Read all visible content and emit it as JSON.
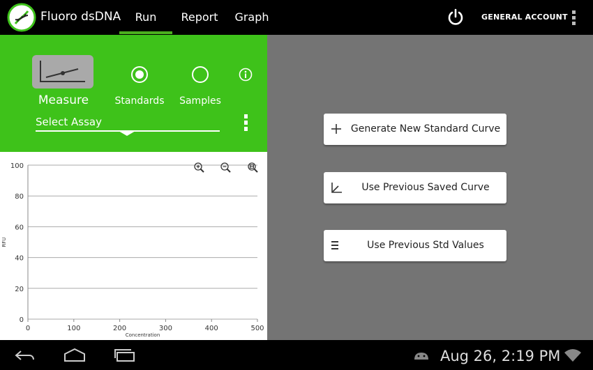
{
  "app": {
    "title": "Fluoro dsDNA",
    "tabs": [
      {
        "label": "Run",
        "active": true
      },
      {
        "label": "Report",
        "active": false
      },
      {
        "label": "Graph",
        "active": false
      }
    ],
    "account_label": "GENERAL ACCOUNT",
    "accent_color": "#4caf1f"
  },
  "run_panel": {
    "measure_label": "Measure",
    "options": [
      {
        "label": "Standards",
        "selected": true
      },
      {
        "label": "Samples",
        "selected": false
      }
    ],
    "assay_placeholder": "Select Assay",
    "panel_color": "#3ec21a"
  },
  "chart_data": {
    "type": "scatter",
    "xlabel": "Concentration",
    "ylabel": "RFU",
    "xlim": [
      0,
      500
    ],
    "ylim": [
      0,
      100
    ],
    "x_ticks": [
      0,
      100,
      200,
      300,
      400,
      500
    ],
    "y_ticks": [
      0,
      20,
      40,
      60,
      80,
      100
    ],
    "grid": "horizontal",
    "series": []
  },
  "actions": [
    {
      "label": "Generate New Standard Curve",
      "icon": "plus-icon"
    },
    {
      "label": "Use Previous Saved Curve",
      "icon": "curve-icon"
    },
    {
      "label": "Use Previous Std Values",
      "icon": "list-icon"
    }
  ],
  "system_bar": {
    "clock": "Aug 26, 2:19 PM"
  }
}
